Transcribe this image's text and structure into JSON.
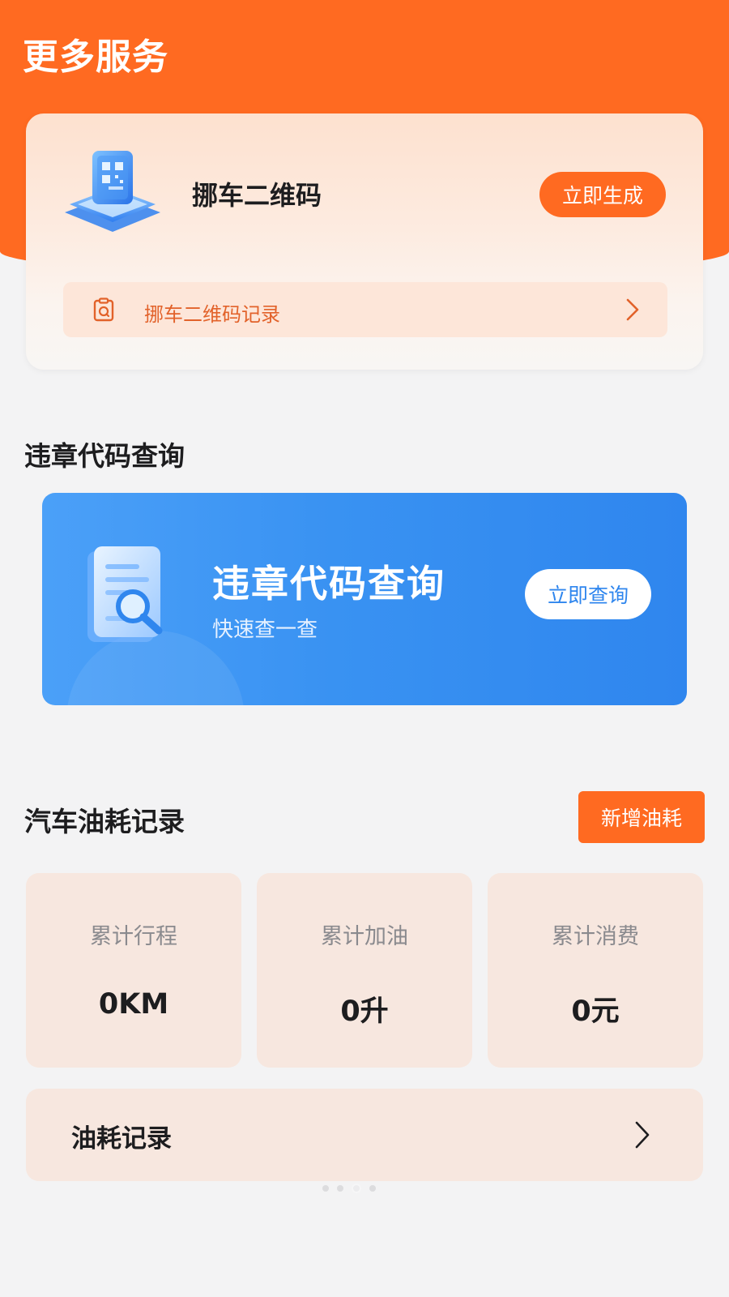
{
  "header": {
    "title": "更多服务"
  },
  "qr_card": {
    "title": "挪车二维码",
    "generate_button": "立即生成",
    "record_row_label": "挪车二维码记录",
    "icons": {
      "main": "qr-code-icon",
      "record": "clipboard-icon",
      "chevron": "chevron-right-icon"
    }
  },
  "violation": {
    "section_title": "违章代码查询",
    "banner_title": "违章代码查询",
    "banner_subtitle": "快速查一查",
    "query_button": "立即查询",
    "icons": {
      "main": "document-search-icon"
    }
  },
  "fuel": {
    "section_title": "汽车油耗记录",
    "add_button": "新增油耗",
    "stats": [
      {
        "label": "累计行程",
        "value": "0KM"
      },
      {
        "label": "累计加油",
        "value": "0升"
      },
      {
        "label": "累计消费",
        "value": "0元"
      }
    ],
    "record_row_label": "油耗记录",
    "icons": {
      "chevron": "chevron-right-icon"
    }
  },
  "pager": {
    "count": 4,
    "active_index": 2
  },
  "colors": {
    "brand_orange": "#ff6a21",
    "banner_blue": "#3992f2",
    "card_peach": "#f7e7df",
    "background": "#f3f3f4"
  }
}
